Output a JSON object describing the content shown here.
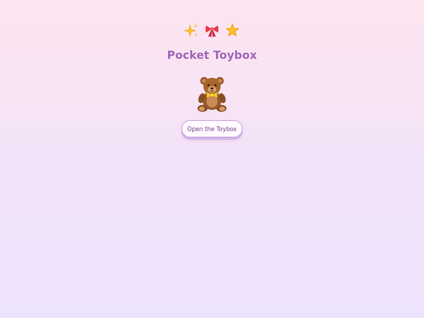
{
  "header": {
    "decorations": [
      {
        "icon": "sparkles-icon"
      },
      {
        "icon": "ribbon-bow-icon"
      },
      {
        "icon": "star-icon"
      }
    ],
    "title": "Pocket Toybox"
  },
  "main": {
    "mascot": {
      "icon": "teddy-bear-icon"
    },
    "open_button_label": "Open the Toybox"
  },
  "colors": {
    "background_top": "#fde5f0",
    "background_bottom": "#eee3fd",
    "title": "#a266b8",
    "button_text": "#7a3f8c",
    "button_border": "#c9a9e2"
  }
}
